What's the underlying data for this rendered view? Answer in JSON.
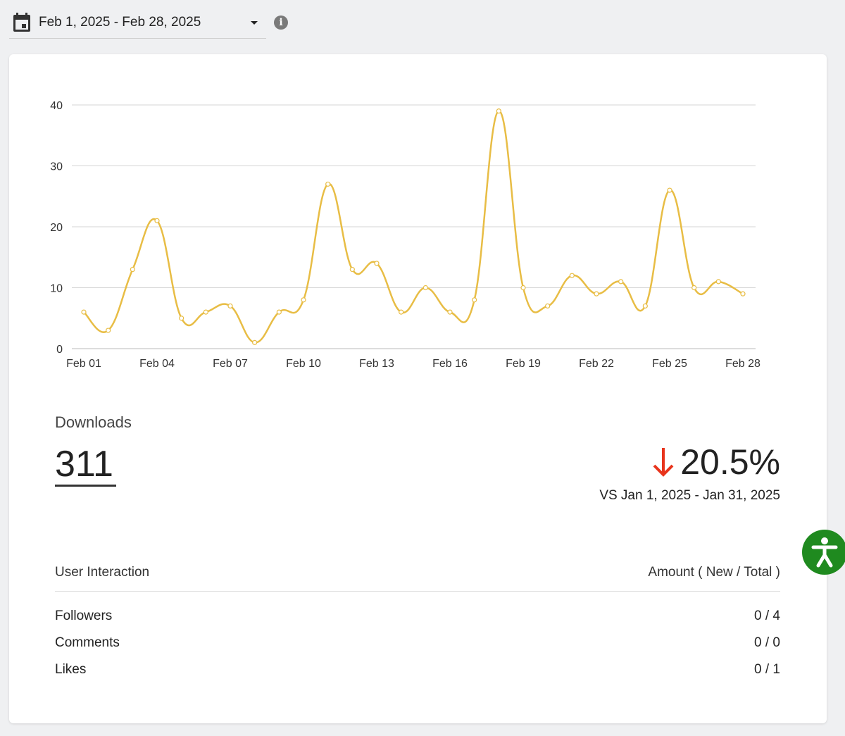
{
  "date_range": {
    "label": "Feb 1, 2025 - Feb 28, 2025",
    "icon": "calendar-icon",
    "info_icon": "info-icon"
  },
  "chart_data": {
    "type": "line",
    "title": "",
    "xlabel": "",
    "ylabel": "",
    "ylim": [
      0,
      40
    ],
    "yticks": [
      "0",
      "10",
      "20",
      "30",
      "40"
    ],
    "xtick_labels": [
      "Feb 01",
      "Feb 04",
      "Feb 07",
      "Feb 10",
      "Feb 13",
      "Feb 16",
      "Feb 19",
      "Feb 22",
      "Feb 25",
      "Feb 28"
    ],
    "x": [
      "Feb 01",
      "Feb 02",
      "Feb 03",
      "Feb 04",
      "Feb 05",
      "Feb 06",
      "Feb 07",
      "Feb 08",
      "Feb 09",
      "Feb 10",
      "Feb 11",
      "Feb 12",
      "Feb 13",
      "Feb 14",
      "Feb 15",
      "Feb 16",
      "Feb 17",
      "Feb 18",
      "Feb 19",
      "Feb 20",
      "Feb 21",
      "Feb 22",
      "Feb 23",
      "Feb 24",
      "Feb 25",
      "Feb 26",
      "Feb 27",
      "Feb 28"
    ],
    "values": [
      6,
      3,
      13,
      21,
      5,
      6,
      7,
      1,
      6,
      8,
      27,
      13,
      14,
      6,
      10,
      6,
      8,
      39,
      10,
      7,
      12,
      9,
      11,
      7,
      26,
      10,
      11,
      9
    ],
    "grid": true,
    "line_color": "#e8bd45"
  },
  "downloads": {
    "title": "Downloads",
    "value": "311"
  },
  "change": {
    "direction": "down",
    "percent": "20.5%",
    "color": "#e8341c",
    "vs": "VS Jan 1, 2025 - Jan 31, 2025"
  },
  "interaction": {
    "header_left": "User Interaction",
    "header_right": "Amount ( New / Total )",
    "rows": [
      {
        "label": "Followers",
        "value": "0 / 4"
      },
      {
        "label": "Comments",
        "value": "0 / 0"
      },
      {
        "label": "Likes",
        "value": "0 / 1"
      }
    ]
  },
  "accessibility": {
    "icon": "accessibility-icon",
    "color": "#1f8a1f"
  }
}
